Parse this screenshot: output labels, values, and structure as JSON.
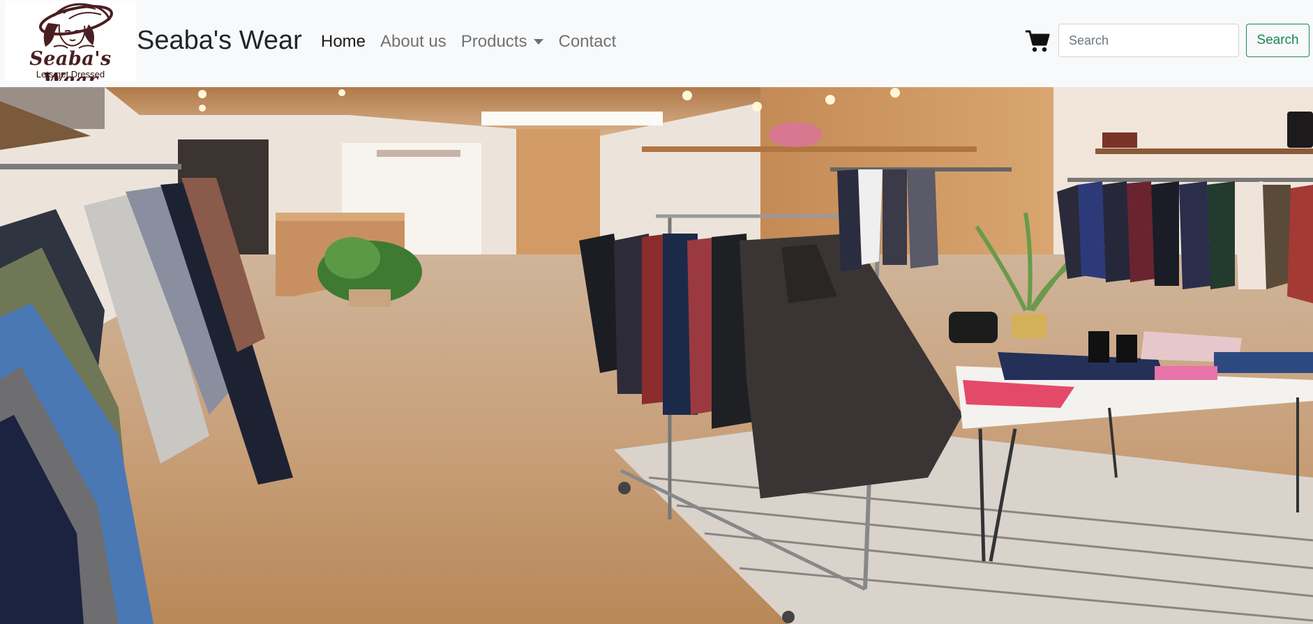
{
  "logo": {
    "name": "Seaba's Wear",
    "tagline": "Lets get Dressed",
    "icon": "woman-with-hat-logo"
  },
  "brand": {
    "title": "Seaba's Wear"
  },
  "nav": {
    "items": [
      {
        "label": "Home",
        "active": true
      },
      {
        "label": "About us",
        "active": false
      },
      {
        "label": "Products",
        "active": false,
        "dropdown": true
      },
      {
        "label": "Contact",
        "active": false
      }
    ]
  },
  "cart": {
    "icon": "shopping-cart-icon"
  },
  "search": {
    "placeholder": "Search",
    "value": "",
    "button_label": "Search"
  },
  "hero": {
    "image": "clothing-store-interior"
  },
  "colors": {
    "accent": "#198754",
    "navbar_bg": "#f8f9fa",
    "logo_text": "#4a1f22"
  }
}
